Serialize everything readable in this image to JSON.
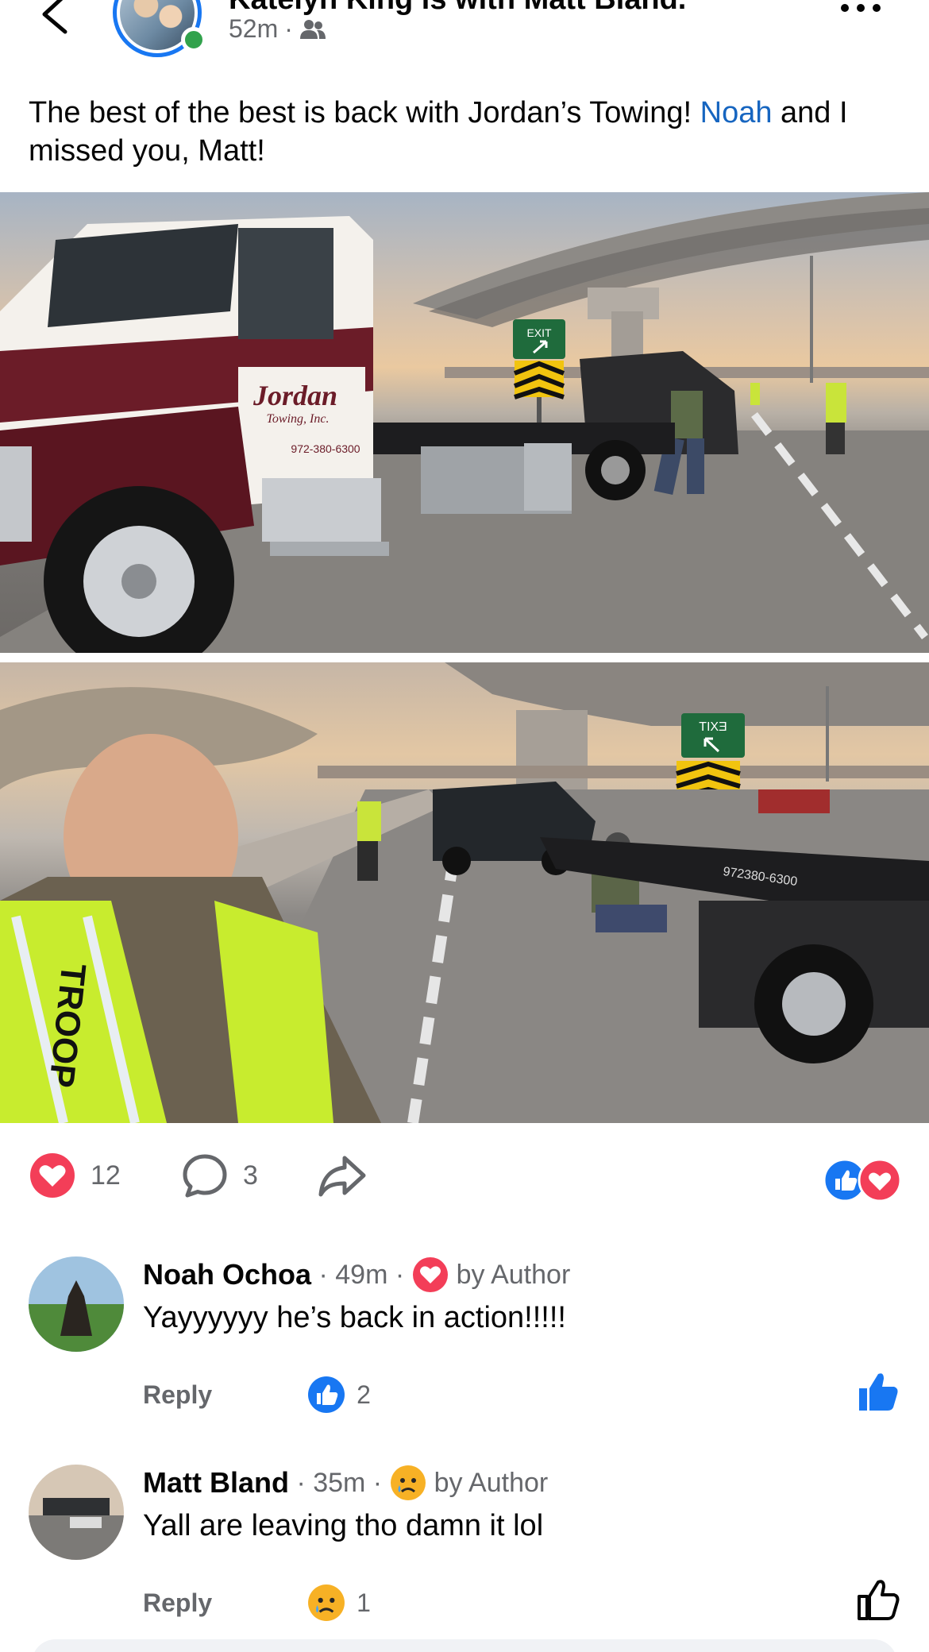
{
  "post": {
    "author_line": "Katelyn King is with Matt Bland.",
    "time": "52m",
    "audience_icon": "friends-icon",
    "text_before": "The best of the best is back with Jordan’s Towing! ",
    "mention": "Noah",
    "text_after": " and I missed you, Matt!",
    "photo1": {
      "truck_name": "Jordan",
      "truck_sub": "Towing, Inc.",
      "truck_phone": "972-380-6300",
      "exit_sign": "EXIT"
    },
    "photo2": {
      "vest_text": "TROOP",
      "exit_sign": "EXIT",
      "truck_text": "972380-6300"
    }
  },
  "actions": {
    "reactions_count": "12",
    "comments_count": "3"
  },
  "comments": [
    {
      "name": "Noah Ochoa",
      "time": "49m",
      "author_reaction": "love",
      "by_author": "by Author",
      "text": "Yayyyyyy he’s back in action!!!!!",
      "reply_label": "Reply",
      "reaction_count": "2",
      "liked": true
    },
    {
      "name": "Matt Bland",
      "time": "35m",
      "author_reaction": "sad",
      "by_author": "by Author",
      "text": "Yall are leaving tho damn it lol",
      "reply_label": "Reply",
      "reaction_count": "1",
      "liked": false
    }
  ],
  "colors": {
    "accent": "#1877f2",
    "love": "#f33e58",
    "online": "#31a24c",
    "mention": "#1665c0"
  }
}
